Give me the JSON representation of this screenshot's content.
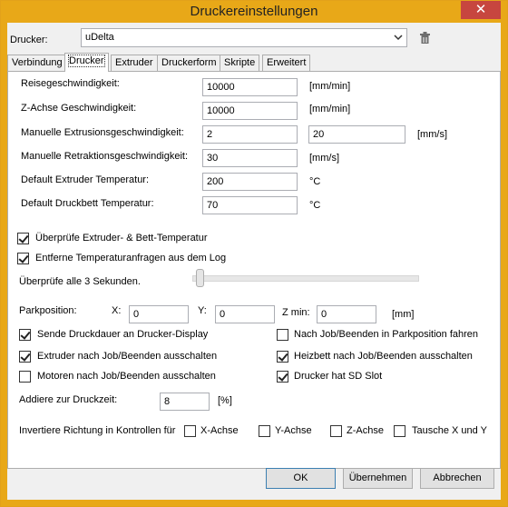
{
  "window": {
    "title": "Druckereinstellungen",
    "close": "✕"
  },
  "printer": {
    "label": "Drucker:",
    "value": "uDelta"
  },
  "tabs": [
    {
      "label": "Verbindung"
    },
    {
      "label": "Drucker"
    },
    {
      "label": "Extruder"
    },
    {
      "label": "Druckerform"
    },
    {
      "label": "Skripte"
    },
    {
      "label": "Erweitert"
    }
  ],
  "fields": {
    "travel_speed": {
      "label": "Reisegeschwindigkeit:",
      "value": "10000",
      "unit": "[mm/min]"
    },
    "z_speed": {
      "label": "Z-Achse Geschwindigkeit:",
      "value": "10000",
      "unit": "[mm/min]"
    },
    "extrusion_speed": {
      "label": "Manuelle Extrusionsgeschwindigkeit:",
      "value1": "2",
      "value2": "20",
      "unit": "[mm/s]"
    },
    "retraction_speed": {
      "label": "Manuelle Retraktionsgeschwindigkeit:",
      "value": "30",
      "unit": "[mm/s]"
    },
    "extruder_temp": {
      "label": "Default Extruder Temperatur:",
      "value": "200",
      "unit": "°C"
    },
    "bed_temp": {
      "label": "Default Druckbett Temperatur:",
      "value": "70",
      "unit": "°C"
    }
  },
  "checks": {
    "check_temp": {
      "label": "Überprüfe Extruder- & Bett-Temperatur",
      "checked": true
    },
    "remove_temp_log": {
      "label": "Entferne Temperaturanfragen aus dem Log",
      "checked": true
    }
  },
  "interval": {
    "label": "Überprüfe alle 3 Sekunden.",
    "level": 0
  },
  "park": {
    "label": "Parkposition:",
    "x_label": "X:",
    "x": "0",
    "y_label": "Y:",
    "y": "0",
    "zmin_label": "Z min:",
    "zmin": "0",
    "unit": "[mm]"
  },
  "options": {
    "send_duration": {
      "label": "Sende Druckdauer an Drucker-Display",
      "checked": true
    },
    "extruder_off": {
      "label": "Extruder nach Job/Beenden ausschalten",
      "checked": true
    },
    "motors_off": {
      "label": "Motoren nach Job/Beenden ausschalten",
      "checked": false
    },
    "park_after_job": {
      "label": "Nach Job/Beenden in Parkposition fahren",
      "checked": false
    },
    "bed_off": {
      "label": "Heizbett nach Job/Beenden ausschalten",
      "checked": true
    },
    "sd_slot": {
      "label": "Drucker hat SD Slot",
      "checked": true
    }
  },
  "print_time": {
    "label": "Addiere zur Druckzeit:",
    "value": "8",
    "unit": "[%]"
  },
  "invert": {
    "label": "Invertiere Richtung in Kontrollen für",
    "x": {
      "label": "X-Achse",
      "checked": false
    },
    "y": {
      "label": "Y-Achse",
      "checked": false
    },
    "z": {
      "label": "Z-Achse",
      "checked": false
    },
    "swap": {
      "label": "Tausche X und Y",
      "checked": false
    }
  },
  "buttons": {
    "ok": "OK",
    "apply": "Übernehmen",
    "cancel": "Abbrechen"
  },
  "icons": {
    "delete": "trash-icon",
    "dropdown": "chevron-down-icon"
  }
}
